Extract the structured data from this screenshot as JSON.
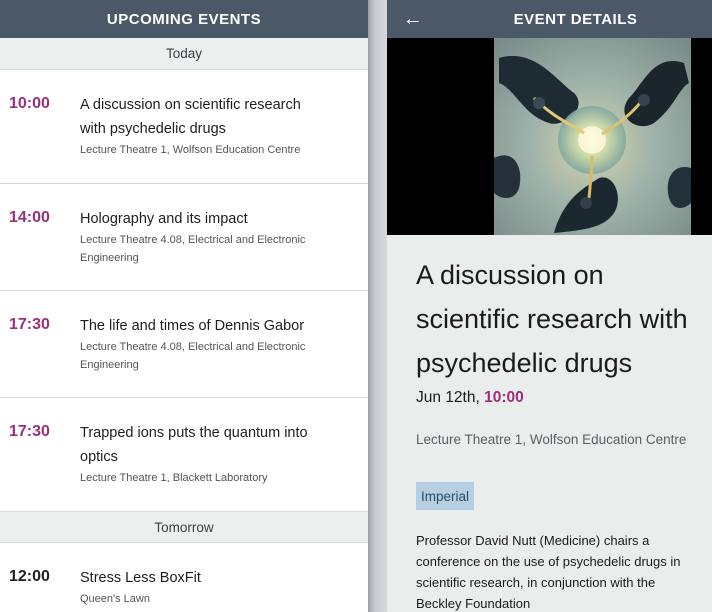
{
  "left": {
    "header": "UPCOMING EVENTS",
    "sections": [
      {
        "day": "Today",
        "events": [
          {
            "time": "10:00",
            "title_lines": [
              "A discussion on scientific research",
              "with psychedelic drugs"
            ],
            "location_lines": [
              "Lecture Theatre 1, Wolfson Education Centre"
            ]
          },
          {
            "time": "14:00",
            "title_lines": [
              "Holography and its impact"
            ],
            "location_lines": [
              "Lecture Theatre 4.08, Electrical and Electronic",
              "Engineering"
            ]
          },
          {
            "time": "17:30",
            "title_lines": [
              "The life and times of Dennis Gabor"
            ],
            "location_lines": [
              "Lecture Theatre 4.08, Electrical and Electronic",
              "Engineering"
            ]
          },
          {
            "time": "17:30",
            "title_lines": [
              "Trapped ions puts the quantum into",
              "optics"
            ],
            "location_lines": [
              "Lecture Theatre 1, Blackett Laboratory"
            ]
          }
        ]
      },
      {
        "day": "Tomorrow",
        "events": [
          {
            "time": "12:00",
            "title_lines": [
              "Stress Less BoxFit"
            ],
            "location_lines": [
              "Queen's Lawn"
            ]
          }
        ]
      }
    ]
  },
  "right": {
    "header": "EVENT DETAILS",
    "back_icon": "←",
    "title_lines": [
      "A discussion on",
      "scientific research with",
      "psychedelic drugs"
    ],
    "date": "Jun 12th,",
    "time": "10:00",
    "location": "Lecture Theatre 1, Wolfson Education Centre",
    "tag": "Imperial",
    "description_lines": [
      "Professor David Nutt (Medicine) chairs a",
      "conference on the use of psychedelic drugs in",
      "scientific research, in conjunction with the",
      "Beckley Foundation"
    ]
  },
  "colors": {
    "header_bg": "#4a5867",
    "accent_time": "#9b2f7d",
    "day_header_bg": "#eaf0ee",
    "tag_bg": "#b7cfe2"
  },
  "icons": {
    "back": "back-arrow-icon"
  }
}
